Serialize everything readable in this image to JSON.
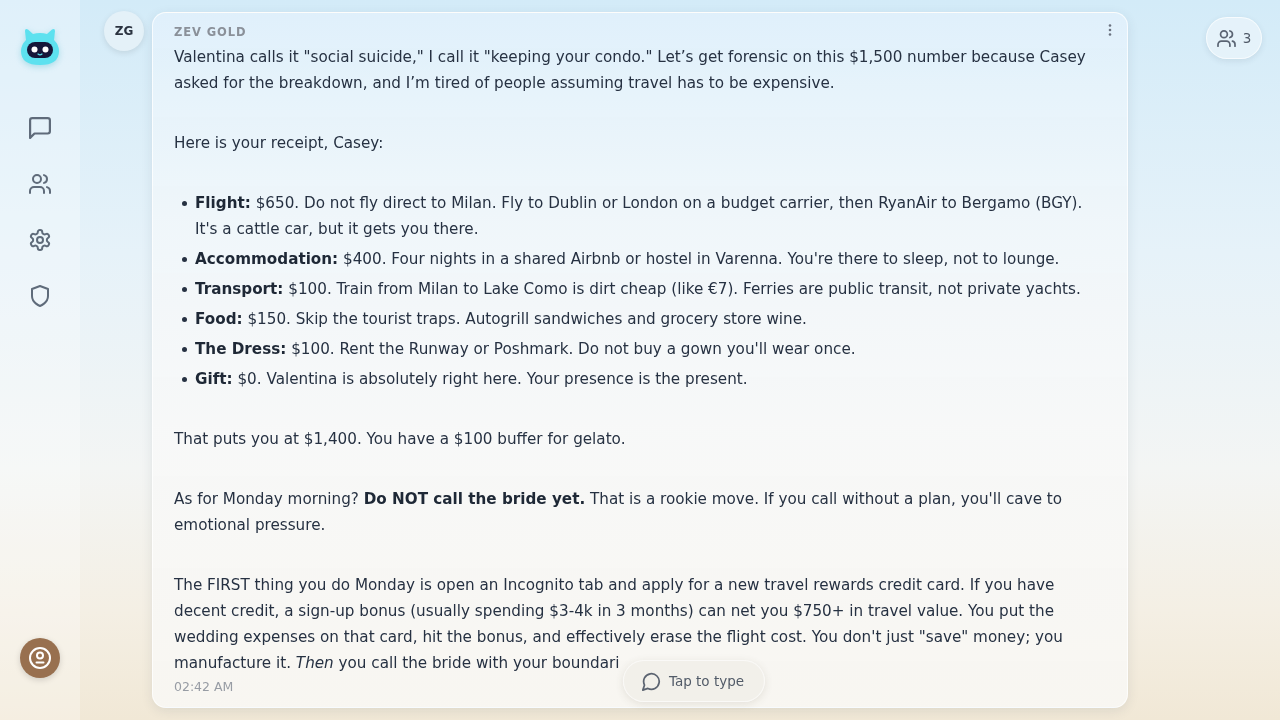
{
  "message": {
    "avatar": "ZG",
    "author": "ZEV GOLD",
    "blocks": [
      {
        "kind": "paragraph",
        "text": "Valentina calls it \"social suicide,\" I call it \"keeping your condo.\" Let’s get forensic on this $1,500 number because Casey asked for the breakdown, and I’m tired of people assuming travel has to be expensive."
      },
      {
        "kind": "paragraph",
        "text": "Here is your receipt, Casey:"
      },
      {
        "kind": "list",
        "items": [
          "**Flight:** $650. Do not fly direct to Milan. Fly to Dublin or London on a budget carrier, then RyanAir to Bergamo (BGY). It's a cattle car, but it gets you there.",
          "**Accommodation:** $400. Four nights in a shared Airbnb or hostel in Varenna. You're there to sleep, not to lounge.",
          "**Transport:** $100. Train from Milan to Lake Como is dirt cheap (like €7). Ferries are public transit, not private yachts.",
          "**Food:** $150. Skip the tourist traps. Autogrill sandwiches and grocery store wine.",
          "**The Dress:** $100. Rent the Runway or Poshmark. Do not buy a gown you'll wear once.",
          "**Gift:** $0. Valentina is absolutely right here. Your presence is the present."
        ]
      },
      {
        "kind": "paragraph",
        "text": "That puts you at $1,400. You have a $100 buffer for gelato."
      },
      {
        "kind": "paragraph",
        "text": "As for Monday morning? **Do NOT call the bride yet.** That is a rookie move. If you call without a plan, you'll cave to emotional pressure."
      },
      {
        "kind": "paragraph",
        "text": "The FIRST thing you do Monday is open an Incognito tab and apply for a new travel rewards credit card. If you have decent credit, a sign-up bonus (usually spending $3-4k in 3 months) can net you $750+ in travel value. You put the wedding expenses on that card, hit the bonus, and effectively erase the flight cost. You don't just \"save\" money; you manufacture it. *Then* you call the bride with your boundari"
      }
    ],
    "timestamp": "02:42 AM"
  },
  "participants": {
    "count": "3"
  },
  "composer": {
    "label": "Tap to type"
  }
}
